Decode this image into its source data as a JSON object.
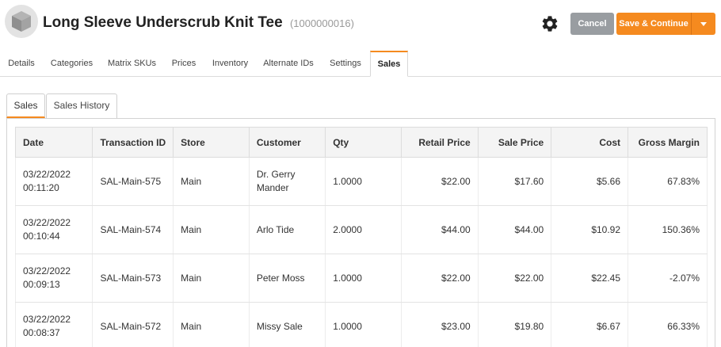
{
  "header": {
    "title": "Long Sleeve Underscrub Knit Tee",
    "sku": "(1000000016)",
    "cancel_label": "Cancel",
    "save_label": "Save & Continue"
  },
  "tabs": [
    {
      "label": "Details"
    },
    {
      "label": "Categories"
    },
    {
      "label": "Matrix SKUs"
    },
    {
      "label": "Prices"
    },
    {
      "label": "Inventory"
    },
    {
      "label": "Alternate IDs"
    },
    {
      "label": "Settings"
    },
    {
      "label": "Sales"
    }
  ],
  "active_tab": "Sales",
  "subtabs": [
    {
      "label": "Sales"
    },
    {
      "label": "Sales History"
    }
  ],
  "table": {
    "headers": [
      "Date",
      "Transaction ID",
      "Store",
      "Customer",
      "Qty",
      "Retail Price",
      "Sale Price",
      "Cost",
      "Gross Margin"
    ],
    "rows": [
      {
        "date": "03/22/2022",
        "time": "00:11:20",
        "txn": "SAL-Main-575",
        "store": "Main",
        "customer": "Dr. Gerry Mander",
        "qty": "1.0000",
        "retail": "$22.00",
        "sale": "$17.60",
        "cost": "$5.66",
        "margin": "67.83%"
      },
      {
        "date": "03/22/2022",
        "time": "00:10:44",
        "txn": "SAL-Main-574",
        "store": "Main",
        "customer": "Arlo Tide",
        "qty": "2.0000",
        "retail": "$44.00",
        "sale": "$44.00",
        "cost": "$10.92",
        "margin": "150.36%"
      },
      {
        "date": "03/22/2022",
        "time": "00:09:13",
        "txn": "SAL-Main-573",
        "store": "Main",
        "customer": "Peter Moss",
        "qty": "1.0000",
        "retail": "$22.00",
        "sale": "$22.00",
        "cost": "$22.45",
        "margin": "-2.07%"
      },
      {
        "date": "03/22/2022",
        "time": "00:08:37",
        "txn": "SAL-Main-572",
        "store": "Main",
        "customer": "Missy Sale",
        "qty": "1.0000",
        "retail": "$23.00",
        "sale": "$19.80",
        "cost": "$6.67",
        "margin": "66.33%"
      }
    ]
  },
  "icons": {
    "logo": "cube-icon",
    "settings": "gear-icon",
    "dropdown": "caret-down-icon"
  },
  "colors": {
    "accent": "#f58a1f",
    "cancel": "#999da1",
    "header_bg": "#f4f4f4"
  }
}
